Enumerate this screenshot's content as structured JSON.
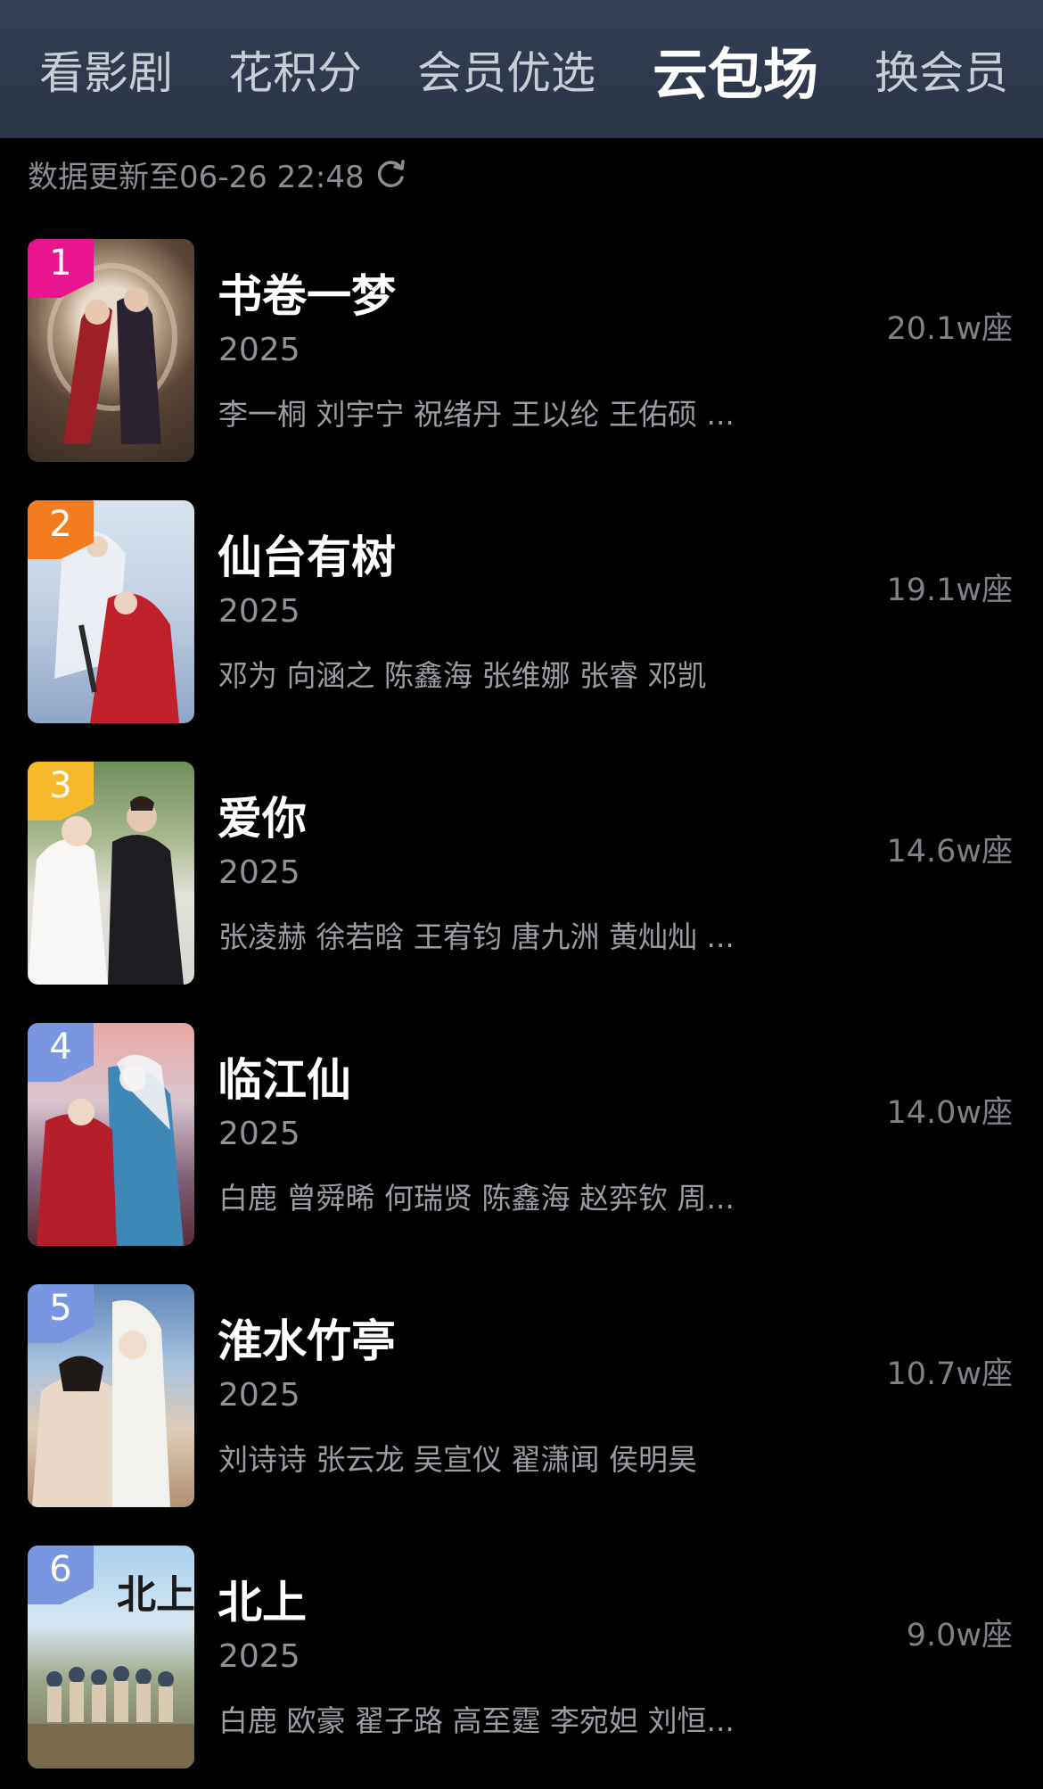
{
  "tabs": [
    "看影剧",
    "花积分",
    "会员优选",
    "云包场",
    "换会员"
  ],
  "active_tab": "云包场",
  "update_text": "数据更新至06-26 22:48",
  "items": [
    {
      "rank": "1",
      "title": "书卷一梦",
      "year": "2025",
      "cast": "李一桐 刘宇宁 祝绪丹 王以纶 王佑硕 ...",
      "seats": "20.1w座"
    },
    {
      "rank": "2",
      "title": "仙台有树",
      "year": "2025",
      "cast": "邓为 向涵之 陈鑫海 张维娜 张睿 邓凯",
      "seats": "19.1w座"
    },
    {
      "rank": "3",
      "title": "爱你",
      "year": "2025",
      "cast": "张凌赫 徐若晗 王宥钧 唐九洲 黄灿灿 ...",
      "seats": "14.6w座"
    },
    {
      "rank": "4",
      "title": "临江仙",
      "year": "2025",
      "cast": "白鹿 曾舜晞 何瑞贤 陈鑫海 赵弈钦 周...",
      "seats": "14.0w座"
    },
    {
      "rank": "5",
      "title": "淮水竹亭",
      "year": "2025",
      "cast": "刘诗诗 张云龙 吴宣仪 翟潇闻 侯明昊",
      "seats": "10.7w座"
    },
    {
      "rank": "6",
      "title": "北上",
      "year": "2025",
      "cast": "白鹿 欧豪 翟子路 高至霆 李宛妲 刘恒...",
      "seats": "9.0w座"
    }
  ],
  "colors": {
    "header_bg": "#2f3a4e",
    "page_bg": "#000000",
    "rank_badges": [
      "#e8158f",
      "#f47c20",
      "#f6b92b",
      "#7b96e0",
      "#7b96e0",
      "#7b96e0"
    ]
  }
}
